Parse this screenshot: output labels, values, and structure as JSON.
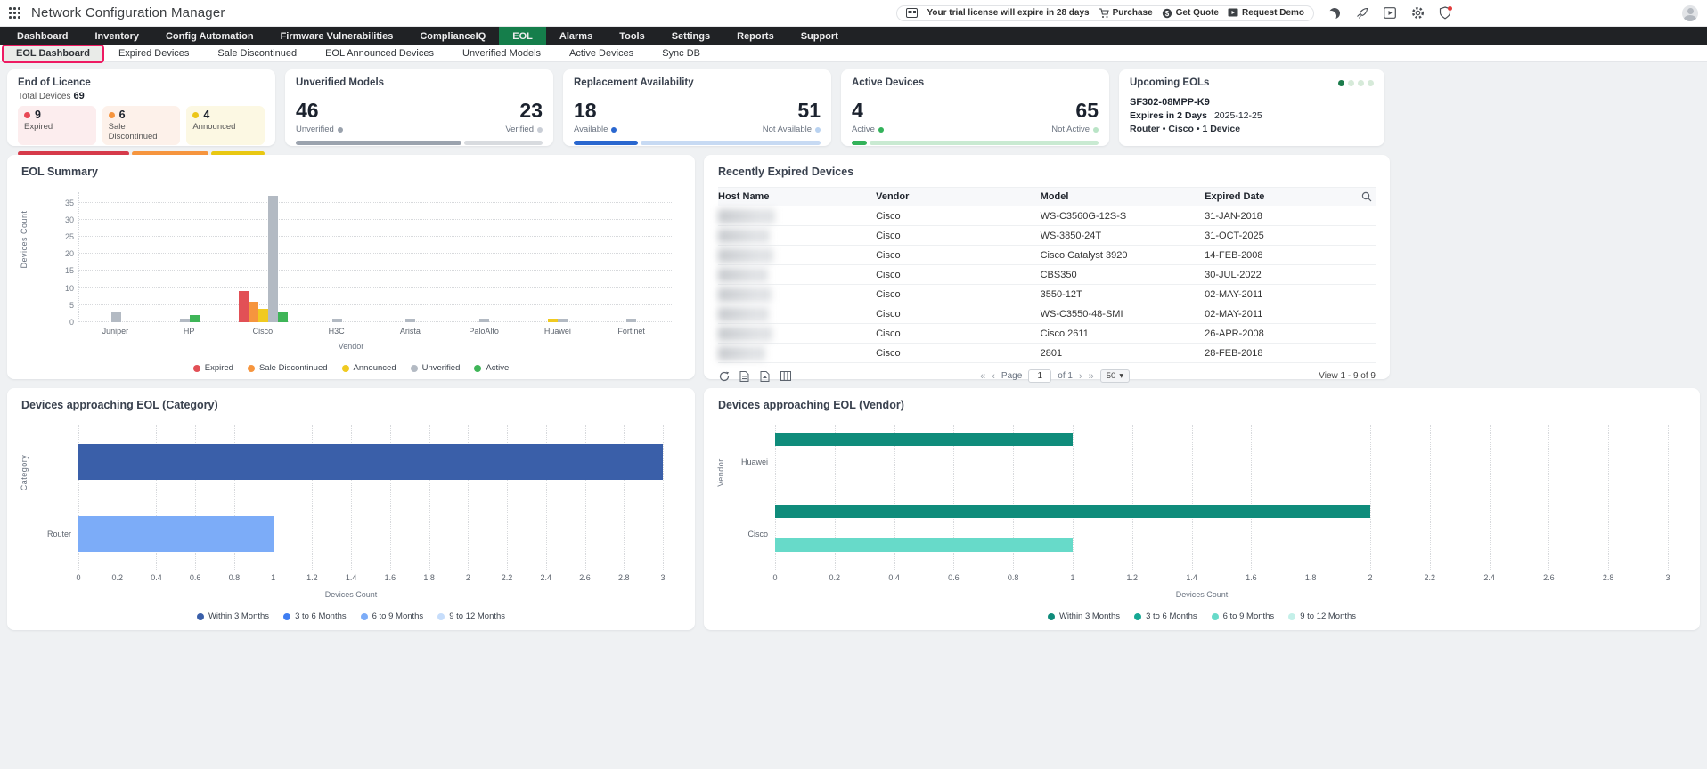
{
  "header": {
    "app_title": "Network Configuration Manager",
    "trial_notice": "Your trial license will expire in 28 days",
    "purchase_label": "Purchase",
    "get_quote_label": "Get Quote",
    "request_demo_label": "Request Demo"
  },
  "nav": {
    "items": [
      "Dashboard",
      "Inventory",
      "Config Automation",
      "Firmware Vulnerabilities",
      "ComplianceIQ",
      "EOL",
      "Alarms",
      "Tools",
      "Settings",
      "Reports",
      "Support"
    ],
    "active": "EOL",
    "active_color": "#157e4b"
  },
  "subnav": {
    "items": [
      "EOL Dashboard",
      "Expired Devices",
      "Sale Discontinued",
      "EOL Announced Devices",
      "Unverified Models",
      "Active Devices",
      "Sync DB"
    ],
    "active": "EOL Dashboard",
    "highlight_color": "#ee1b63"
  },
  "cards": {
    "end_of_licence": {
      "title": "End of Licence",
      "total_label": "Total Devices",
      "total_value": "69",
      "stats": [
        {
          "value": "9",
          "label": "Expired",
          "dot": "#e84855",
          "bg": "#fcedee"
        },
        {
          "value": "6",
          "label": "Sale Discontinued",
          "dot": "#f6953e",
          "bg": "#fdf1ea"
        },
        {
          "value": "4",
          "label": "Announced",
          "dot": "#ecc619",
          "bg": "#fcf8e3"
        }
      ],
      "bar": [
        {
          "color": "#d63a4a",
          "pct": 46
        },
        {
          "color": "#f6953e",
          "pct": 32
        },
        {
          "color": "#e9c812",
          "pct": 22
        }
      ]
    },
    "unverified_models": {
      "title": "Unverified Models",
      "left_value": "46",
      "left_label": "Unverified",
      "left_dot": "#9aa2ad",
      "right_value": "23",
      "right_label": "Verified",
      "right_dot": "#c9ced6",
      "bar_fill": "#9ba3ae",
      "bar_rest": "#d8dbdf",
      "bar_pct": 67
    },
    "replacement_availability": {
      "title": "Replacement Availability",
      "left_value": "18",
      "left_label": "Available",
      "left_dot": "#2a67cf",
      "right_value": "51",
      "right_label": "Not Available",
      "right_dot": "#b9d2f0",
      "bar_fill": "#2a67cf",
      "bar_rest": "#c7daf3",
      "bar_pct": 26
    },
    "active_devices": {
      "title": "Active Devices",
      "left_value": "4",
      "left_label": "Active",
      "left_dot": "#33b25a",
      "right_value": "65",
      "right_label": "Not Active",
      "right_dot": "#b9e4c6",
      "bar_fill": "#33b25a",
      "bar_rest": "#c9ead2",
      "bar_pct": 6
    },
    "upcoming_eols": {
      "title": "Upcoming EOLs",
      "model": "SF302-08MPP-K9",
      "expires_label": "Expires in 2 Days",
      "expires_date": "2025-12-25",
      "meta": "Router • Cisco • 1 Device",
      "dot_count": 4,
      "dot_active_color": "#1c7c4c",
      "dot_inactive_color": "#d6ead9"
    }
  },
  "expired_table": {
    "title": "Recently Expired Devices",
    "columns": [
      "Host Name",
      "Vendor",
      "Model",
      "Expired Date"
    ],
    "rows": [
      {
        "host": "",
        "vendor": "Cisco",
        "model": "WS-C3560G-12S-S",
        "expired": "31-JAN-2018"
      },
      {
        "host": "",
        "vendor": "Cisco",
        "model": "WS-3850-24T",
        "expired": "31-OCT-2025"
      },
      {
        "host": "",
        "vendor": "Cisco",
        "model": "Cisco Catalyst 3920",
        "expired": "14-FEB-2008"
      },
      {
        "host": "",
        "vendor": "Cisco",
        "model": "CBS350",
        "expired": "30-JUL-2022"
      },
      {
        "host": "",
        "vendor": "Cisco",
        "model": "3550-12T",
        "expired": "02-MAY-2011"
      },
      {
        "host": "",
        "vendor": "Cisco",
        "model": "WS-C3550-48-SMI",
        "expired": "02-MAY-2011"
      },
      {
        "host": "",
        "vendor": "Cisco",
        "model": "Cisco 2611",
        "expired": "26-APR-2008"
      },
      {
        "host": "",
        "vendor": "Cisco",
        "model": "2801",
        "expired": "28-FEB-2018"
      }
    ],
    "pagination": {
      "page_label": "Page",
      "page": "1",
      "of_label": "of 1",
      "page_size": "50",
      "view_label": "View 1 - 9 of 9"
    }
  },
  "chart_data": [
    {
      "type": "bar",
      "title": "EOL Summary",
      "xlabel": "Vendor",
      "ylabel": "Devices Count",
      "categories": [
        "Juniper",
        "HP",
        "Cisco",
        "H3C",
        "Arista",
        "PaloAlto",
        "Huawei",
        "Fortinet"
      ],
      "series": [
        {
          "name": "Expired",
          "color": "#e25056",
          "values": [
            0,
            0,
            9,
            0,
            0,
            0,
            0,
            0
          ]
        },
        {
          "name": "Sale Discontinued",
          "color": "#f6953e",
          "values": [
            0,
            0,
            6,
            0,
            0,
            0,
            0,
            0
          ]
        },
        {
          "name": "Announced",
          "color": "#f0ca20",
          "values": [
            0,
            0,
            4,
            0,
            0,
            0,
            1,
            0
          ]
        },
        {
          "name": "Unverified",
          "color": "#b3bac3",
          "values": [
            3,
            1,
            37,
            1,
            1,
            1,
            1,
            1
          ]
        },
        {
          "name": "Active",
          "color": "#3fb558",
          "values": [
            0,
            2,
            3,
            0,
            0,
            0,
            0,
            0
          ]
        }
      ],
      "ymax": 38,
      "yticks": [
        0,
        5,
        10,
        15,
        20,
        25,
        30,
        35
      ],
      "grid": true,
      "legend_position": "bottom"
    },
    {
      "type": "bar",
      "orientation": "horizontal",
      "title": "Devices approaching EOL (Category)",
      "xlabel": "Devices Count",
      "ylabel": "Category",
      "categories": [
        "",
        "Router"
      ],
      "series": [
        {
          "name": "Within 3 Months",
          "color": "#3a5fa9",
          "values": [
            3,
            0
          ]
        },
        {
          "name": "3 to 6 Months",
          "color": "#3f7ef2",
          "values": [
            0,
            0
          ]
        },
        {
          "name": "6 to 9 Months",
          "color": "#7cacf8",
          "values": [
            0,
            1
          ]
        },
        {
          "name": "9 to 12 Months",
          "color": "#c6ddfb",
          "values": [
            0,
            0
          ]
        }
      ],
      "xmax": 3,
      "xticks": [
        "0",
        "0.2",
        "0.4",
        "0.6",
        "0.8",
        "1",
        "1.2",
        "1.4",
        "1.6",
        "1.8",
        "2",
        "2.2",
        "2.4",
        "2.6",
        "2.8",
        "3"
      ],
      "bar_style": "thick",
      "grid": true,
      "legend_position": "bottom"
    },
    {
      "type": "bar",
      "orientation": "horizontal",
      "title": "Devices approaching EOL (Vendor)",
      "xlabel": "Devices Count",
      "ylabel": "Vendor",
      "categories": [
        "Huawei",
        "Cisco"
      ],
      "series": [
        {
          "name": "Within 3 Months",
          "color": "#0f8c7b",
          "values": [
            1,
            2
          ]
        },
        {
          "name": "3 to 6 Months",
          "color": "#16a894",
          "values": [
            0,
            0
          ]
        },
        {
          "name": "6 to 9 Months",
          "color": "#67dac9",
          "values": [
            0,
            1
          ]
        },
        {
          "name": "9 to 12 Months",
          "color": "#c4f0e9",
          "values": [
            0,
            0
          ]
        }
      ],
      "xmax": 3,
      "xticks": [
        "0",
        "0.2",
        "0.4",
        "0.6",
        "0.8",
        "1",
        "1.2",
        "1.4",
        "1.6",
        "1.8",
        "2",
        "2.2",
        "2.4",
        "2.6",
        "2.8",
        "3"
      ],
      "bar_style": "thin",
      "grid": true,
      "legend_position": "bottom"
    }
  ]
}
